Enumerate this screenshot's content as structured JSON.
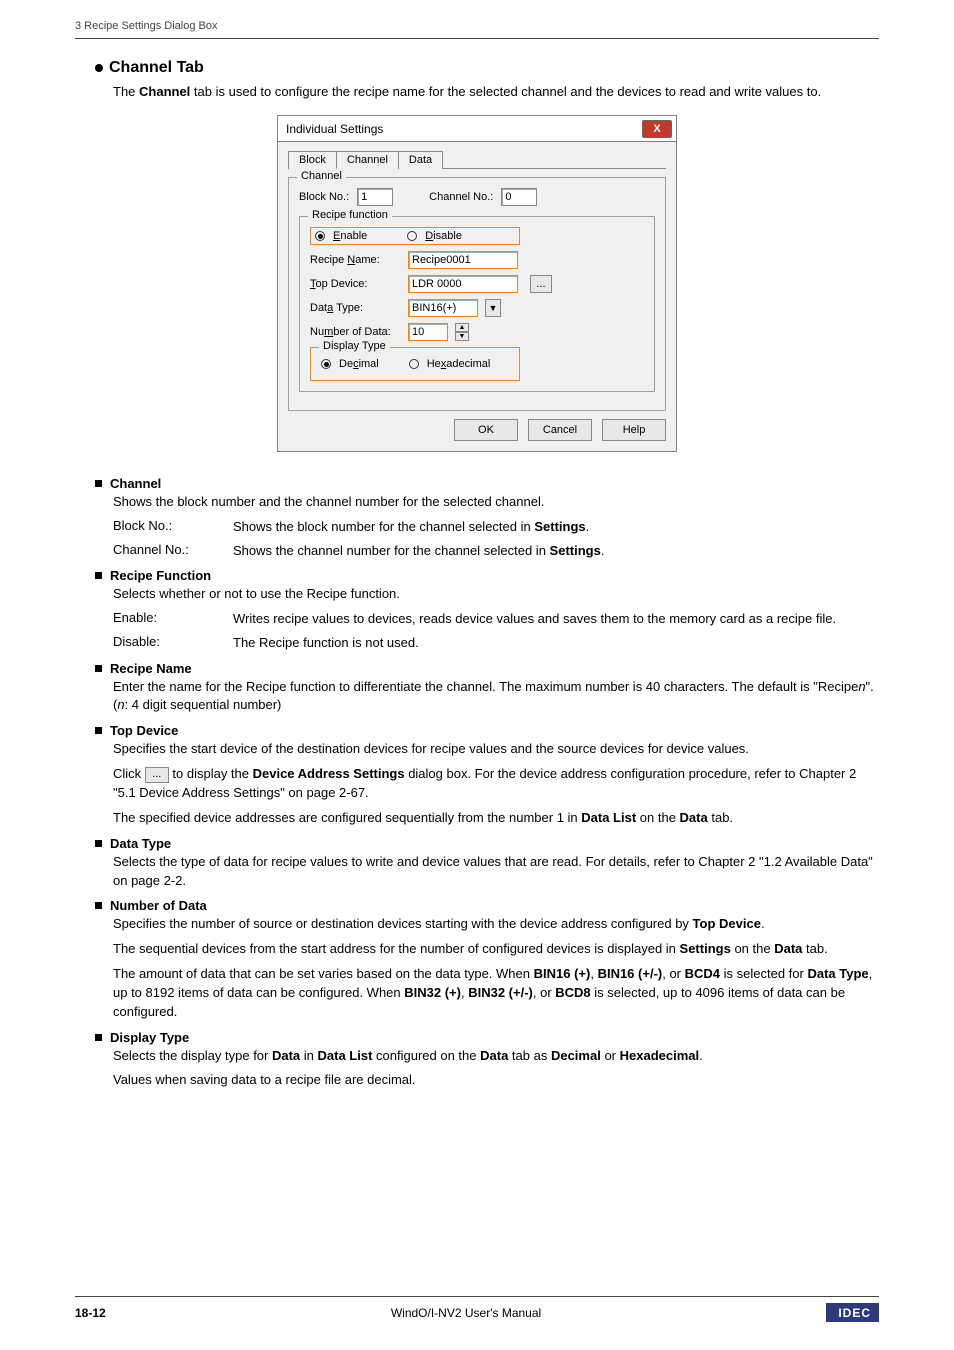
{
  "header": {
    "left": "3 Recipe Settings Dialog Box"
  },
  "sec_channel_tab": {
    "title": "Channel Tab",
    "pre": "The ",
    "bold": "Channel",
    "post": " tab is used to configure the recipe name for the selected channel and the devices to read and write values to."
  },
  "dialog": {
    "title": "Individual Settings",
    "tabs": [
      "Block",
      "Channel",
      "Data"
    ],
    "channel_group": "Channel",
    "block_no_lbl": "Block No.:",
    "block_no_val": "1",
    "channel_no_lbl": "Channel No.:",
    "channel_no_val": "0",
    "recipe_func_group": "Recipe function",
    "enable": "Enable",
    "disable": "Disable",
    "recipe_name_lbl": "Recipe Name:",
    "recipe_name_val": "Recipe0001",
    "top_device_lbl": "Top Device:",
    "top_device_val": "LDR 0000",
    "data_type_lbl": "Data Type:",
    "data_type_val": "BIN16(+)",
    "num_data_lbl": "Number of Data:",
    "num_data_val": "10",
    "display_type_group": "Display Type",
    "decimal": "Decimal",
    "hex": "Hexadecimal",
    "ok": "OK",
    "cancel": "Cancel",
    "help": "Help"
  },
  "channel_section": {
    "title": "Channel",
    "desc": "Shows the block number and the channel number for the selected channel.",
    "defs": [
      {
        "term": "Block No.:",
        "pre": "Shows the block number for the channel selected in ",
        "bold": "Settings",
        "post": "."
      },
      {
        "term": "Channel No.:",
        "pre": "Shows the channel number for the channel selected in ",
        "bold": "Settings",
        "post": "."
      }
    ]
  },
  "recipe_function": {
    "title": "Recipe Function",
    "desc": "Selects whether or not to use the Recipe function.",
    "defs": [
      {
        "term": "Enable:",
        "val": "Writes recipe values to devices, reads device values and saves them to the memory card as a recipe file."
      },
      {
        "term": "Disable:",
        "val": "The Recipe function is not used."
      }
    ]
  },
  "recipe_name": {
    "title": "Recipe Name",
    "line1_pre": "Enter the name for the Recipe function to differentiate the channel. The maximum number is 40 characters. The default is \"Recipe",
    "line1_n1": "n",
    "line1_mid": "\". (",
    "line1_n2": "n",
    "line1_post": ": 4 digit sequential number)"
  },
  "top_device": {
    "title": "Top Device",
    "desc": "Specifies the start device of the destination devices for recipe values and the source devices for device values.",
    "click_pre": "Click ",
    "click_mid": " to display the ",
    "click_bold": "Device Address Settings",
    "click_post": " dialog box. For the device address configuration procedure, refer to Chapter 2 \"5.1 Device Address Settings\" on page 2-67.",
    "note_pre": "The specified device addresses are configured sequentially from the number 1 in ",
    "note_b1": "Data List",
    "note_mid": " on the ",
    "note_b2": "Data",
    "note_post": " tab."
  },
  "data_type": {
    "title": "Data Type",
    "desc": "Selects the type of data for recipe values to write and device values that are read. For details, refer to Chapter 2 \"1.2 Available Data\" on page 2-2."
  },
  "number_of_data": {
    "title": "Number of Data"
  },
  "num_data_texts": {
    "p1_pre": "Specifies the number of source or destination devices starting with the device address configured by ",
    "p1_b": "Top Device",
    "p1_post": ".",
    "p2_pre": "The sequential devices from the start address for the number of configured devices is displayed in ",
    "p2_b1": "Settings",
    "p2_mid": " on the ",
    "p2_b2": "Data",
    "p2_post": " tab.",
    "p3_pre": "The amount of data that can be set varies based on the data type. When ",
    "p3_b1": "BIN16 (+)",
    "p3_c1": ", ",
    "p3_b2": "BIN16 (+/-)",
    "p3_c2": ", or ",
    "p3_b3": "BCD4",
    "p3_mid1": " is selected for ",
    "p3_b4": "Data Type",
    "p3_mid2": ", up to 8192 items of data can be configured. When ",
    "p3_b5": "BIN32 (+)",
    "p3_c3": ", ",
    "p3_b6": "BIN32 (+/-)",
    "p3_c4": ", or ",
    "p3_b7": "BCD8",
    "p3_post": " is selected, up to 4096 items of data can be configured."
  },
  "display_type": {
    "title": "Display Type",
    "p1_pre": "Selects the display type for ",
    "p1_b1": "Data",
    "p1_m1": " in ",
    "p1_b2": "Data List",
    "p1_m2": " configured on the ",
    "p1_b3": "Data",
    "p1_m3": " tab as ",
    "p1_b4": "Decimal",
    "p1_m4": " or ",
    "p1_b5": "Hexadecimal",
    "p1_post": ".",
    "p2": "Values when saving data to a recipe file are decimal."
  },
  "footer": {
    "page": "18-12",
    "center": "WindO/I-NV2 User's Manual",
    "brand": "IDEC"
  },
  "glyphs": {
    "ellipsis": "...",
    "x": "X",
    "down": "▼",
    "up": "▲",
    "dn2": "▼"
  }
}
